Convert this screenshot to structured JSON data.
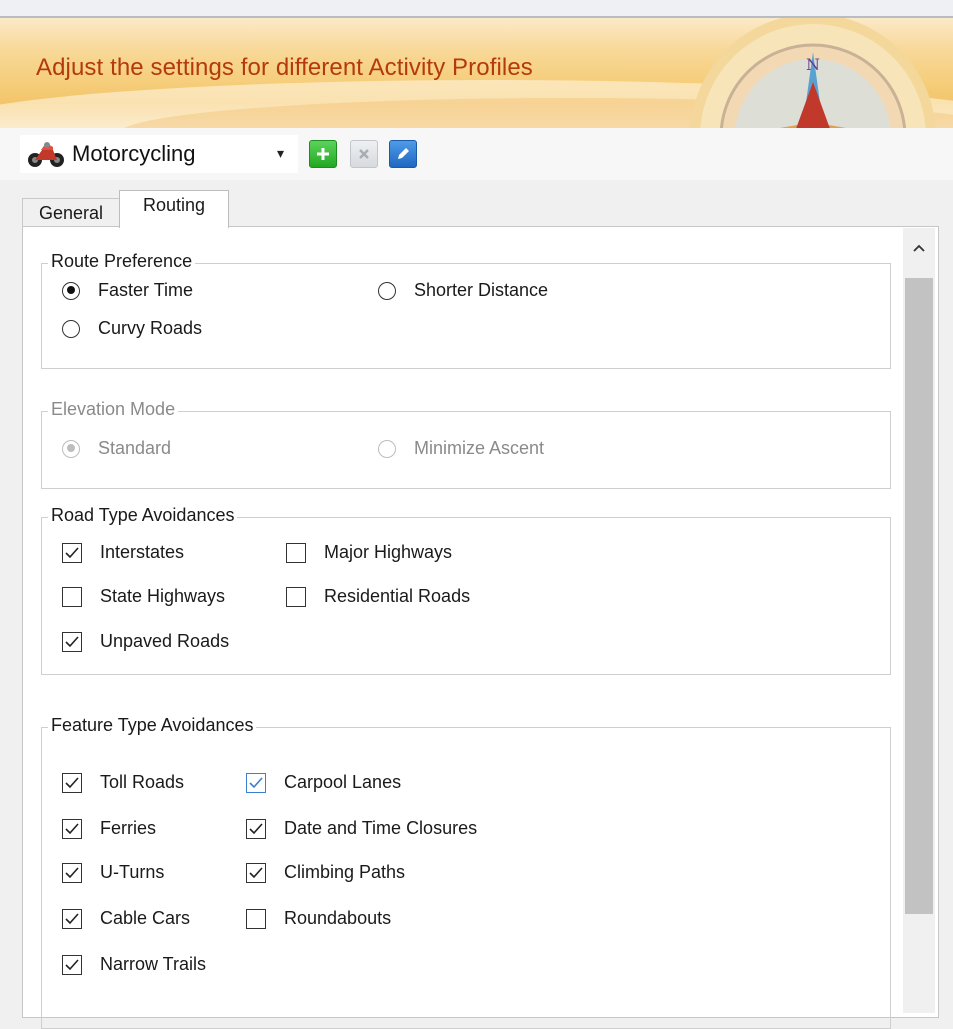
{
  "banner": {
    "title": "Adjust the settings for different Activity Profiles",
    "compass_letter": "N"
  },
  "toolbar": {
    "profile_selected": "Motorcycling",
    "icons": {
      "profile": "motorcycle-icon",
      "add": "add-icon",
      "delete": "delete-icon",
      "edit": "edit-icon",
      "dropdown": "chevron-down-icon"
    }
  },
  "tabs": [
    {
      "label": "General",
      "active": false
    },
    {
      "label": "Routing",
      "active": true
    }
  ],
  "route_preference": {
    "title": "Route Preference",
    "options": [
      {
        "label": "Faster Time",
        "checked": true
      },
      {
        "label": "Shorter Distance",
        "checked": false
      },
      {
        "label": "Curvy Roads",
        "checked": false
      }
    ]
  },
  "elevation_mode": {
    "title": "Elevation Mode",
    "enabled": false,
    "options": [
      {
        "label": "Standard",
        "checked": true
      },
      {
        "label": "Minimize Ascent",
        "checked": false
      }
    ]
  },
  "road_type_avoidances": {
    "title": "Road Type Avoidances",
    "items": [
      {
        "label": "Interstates",
        "checked": true
      },
      {
        "label": "Major Highways",
        "checked": false
      },
      {
        "label": "State Highways",
        "checked": false
      },
      {
        "label": "Residential Roads",
        "checked": false
      },
      {
        "label": "Unpaved Roads",
        "checked": true
      }
    ]
  },
  "feature_type_avoidances": {
    "title": "Feature Type Avoidances",
    "items": [
      {
        "label": "Toll Roads",
        "checked": true
      },
      {
        "label": "Carpool Lanes",
        "checked": true
      },
      {
        "label": "Ferries",
        "checked": true
      },
      {
        "label": "Date and Time Closures",
        "checked": true
      },
      {
        "label": "U-Turns",
        "checked": true
      },
      {
        "label": "Climbing Paths",
        "checked": true
      },
      {
        "label": "Cable Cars",
        "checked": true
      },
      {
        "label": "Roundabouts",
        "checked": false
      },
      {
        "label": "Narrow Trails",
        "checked": true
      }
    ]
  },
  "colors": {
    "banner_title": "#b43a0b",
    "accent_blue": "#3b7fd1",
    "add_green": "#23a823"
  }
}
